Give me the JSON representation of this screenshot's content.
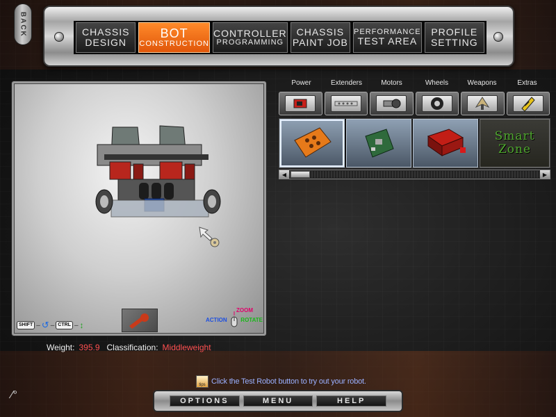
{
  "back_label": "BACK",
  "nav_tabs": [
    {
      "line1": "CHASSIS",
      "line2": "DESIGN",
      "active": false
    },
    {
      "line1": "BOT",
      "line2": "CONSTRUCTION",
      "active": true
    },
    {
      "line1": "CONTROLLER",
      "line2": "PROGRAMMING",
      "active": false
    },
    {
      "line1": "CHASSIS",
      "line2": "PAINT JOB",
      "active": false
    },
    {
      "line1": "PERFORMANCE",
      "line2": "TEST AREA",
      "active": false
    },
    {
      "line1": "PROFILE",
      "line2": "SETTING",
      "active": false
    }
  ],
  "viewport": {
    "shift_key": "SHIFT",
    "ctrl_key": "CTRL",
    "zoom_label": "ZOOM",
    "action_label": "ACTION",
    "rotate_label": "ROTATE"
  },
  "categories": [
    {
      "label": "Power",
      "icon": "battery-icon"
    },
    {
      "label": "Extenders",
      "icon": "extender-bar-icon"
    },
    {
      "label": "Motors",
      "icon": "motor-icon"
    },
    {
      "label": "Wheels",
      "icon": "wheel-icon"
    },
    {
      "label": "Weapons",
      "icon": "weapon-icon"
    },
    {
      "label": "Extras",
      "icon": "extras-icon"
    }
  ],
  "parts": [
    {
      "name": "orange-battery-pack",
      "selected": true
    },
    {
      "name": "green-circuit-board",
      "selected": false
    },
    {
      "name": "red-power-unit",
      "selected": false
    }
  ],
  "smart_zone": {
    "line1": "Smart",
    "line2": "Zone"
  },
  "stats": {
    "weight_label": "Weight:",
    "weight_value": "395.9",
    "class_label": "Classification:",
    "class_value": "Middleweight"
  },
  "tip": {
    "icon_label": "tips",
    "text": "Click the Test Robot button to try out your robot."
  },
  "bottom_menu": {
    "options": "OPTIONS",
    "menu": "MENU",
    "help": "HELP"
  },
  "colors": {
    "accent": "#e86a14",
    "value_red": "#ff5050",
    "smart_zone_green": "#4fa72e",
    "tip_blue": "#9ab0ff"
  }
}
